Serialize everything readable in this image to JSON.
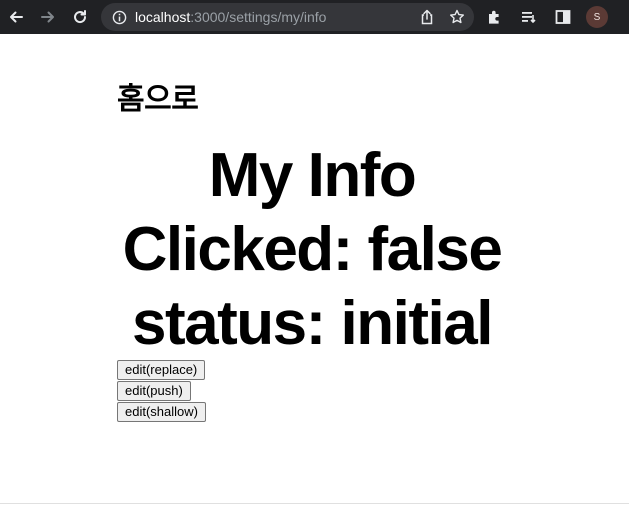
{
  "browser": {
    "url_host": "localhost",
    "url_path": ":3000/settings/my/info",
    "avatar_initial": "S",
    "icons": [
      "back-arrow-icon",
      "forward-arrow-icon",
      "reload-icon",
      "info-icon",
      "share-icon",
      "star-icon",
      "extensions-icon",
      "reading-list-icon",
      "side-panel-icon"
    ]
  },
  "page": {
    "home_link": "홈으로",
    "heading_lines": [
      "My Info",
      "Clicked: false",
      "status: initial"
    ],
    "buttons": {
      "replace": "edit(replace)",
      "push": "edit(push)",
      "shallow": "edit(shallow)"
    }
  },
  "colors": {
    "toolbar_bg": "#202124",
    "omnibox_bg": "#35363a",
    "page_bg": "#ffffff"
  }
}
